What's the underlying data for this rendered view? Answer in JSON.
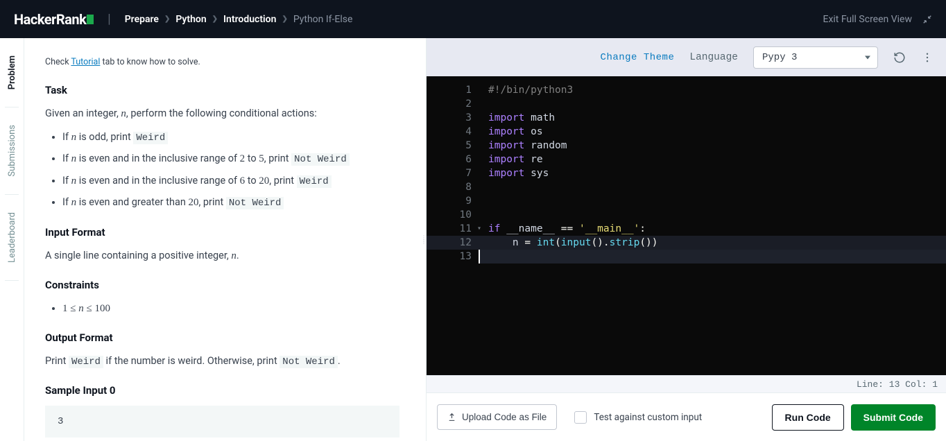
{
  "header": {
    "logo_text": "HackerRank",
    "breadcrumb": [
      "Prepare",
      "Python",
      "Introduction"
    ],
    "current_page": "Python If-Else",
    "exit_fs_label": "Exit Full Screen View"
  },
  "side_tabs": [
    {
      "label": "Problem",
      "active": true
    },
    {
      "label": "Submissions",
      "active": false
    },
    {
      "label": "Leaderboard",
      "active": false
    }
  ],
  "problem": {
    "hint_prefix": "Check ",
    "hint_link": "Tutorial",
    "hint_suffix": " tab to know how to solve.",
    "task_heading": "Task",
    "task_intro": "Given an integer, n, perform the following conditional actions:",
    "rules": [
      {
        "pre": "If ",
        "var": "n",
        "post": " is odd, print ",
        "code": "Weird"
      },
      {
        "pre": "If ",
        "var": "n",
        "post": " is even and in the inclusive range of 2 to 5, print ",
        "code": "Not Weird"
      },
      {
        "pre": "If ",
        "var": "n",
        "post": " is even and in the inclusive range of 6 to 20, print ",
        "code": "Weird"
      },
      {
        "pre": "If ",
        "var": "n",
        "post": " is even and greater than 20, print ",
        "code": "Not Weird"
      }
    ],
    "input_heading": "Input Format",
    "input_desc": "A single line containing a positive integer, n.",
    "constraints_heading": "Constraints",
    "constraint": "1 ≤ n ≤ 100",
    "output_heading": "Output Format",
    "output_desc_pre": "Print ",
    "output_code1": "Weird",
    "output_desc_mid": " if the number is weird. Otherwise, print ",
    "output_code2": "Not Weird",
    "output_desc_post": ".",
    "sample_input_heading": "Sample Input 0",
    "sample_input": "3"
  },
  "toolbar": {
    "change_theme": "Change Theme",
    "language_label": "Language",
    "language_selected": "Pypy 3"
  },
  "code": {
    "lines": [
      {
        "n": 1,
        "tokens": [
          [
            "comment",
            "#!/bin/python3"
          ]
        ]
      },
      {
        "n": 2,
        "tokens": []
      },
      {
        "n": 3,
        "tokens": [
          [
            "kw",
            "import"
          ],
          [
            "sp",
            " "
          ],
          [
            "mod",
            "math"
          ]
        ]
      },
      {
        "n": 4,
        "tokens": [
          [
            "kw",
            "import"
          ],
          [
            "sp",
            " "
          ],
          [
            "mod",
            "os"
          ]
        ]
      },
      {
        "n": 5,
        "tokens": [
          [
            "kw",
            "import"
          ],
          [
            "sp",
            " "
          ],
          [
            "mod",
            "random"
          ]
        ]
      },
      {
        "n": 6,
        "tokens": [
          [
            "kw",
            "import"
          ],
          [
            "sp",
            " "
          ],
          [
            "mod",
            "re"
          ]
        ]
      },
      {
        "n": 7,
        "tokens": [
          [
            "kw",
            "import"
          ],
          [
            "sp",
            " "
          ],
          [
            "mod",
            "sys"
          ]
        ]
      },
      {
        "n": 8,
        "tokens": []
      },
      {
        "n": 9,
        "tokens": []
      },
      {
        "n": 10,
        "tokens": []
      },
      {
        "n": 11,
        "fold": true,
        "tokens": [
          [
            "kw",
            "if"
          ],
          [
            "sp",
            " "
          ],
          [
            "mod",
            "__name__"
          ],
          [
            "sp",
            " "
          ],
          [
            "punc",
            "=="
          ],
          [
            "sp",
            " "
          ],
          [
            "str",
            "'__main__'"
          ],
          [
            "punc",
            ":"
          ]
        ]
      },
      {
        "n": 12,
        "hl": true,
        "tokens": [
          [
            "sp",
            "    "
          ],
          [
            "mod",
            "n "
          ],
          [
            "punc",
            "="
          ],
          [
            "sp",
            " "
          ],
          [
            "fn",
            "int"
          ],
          [
            "punc",
            "("
          ],
          [
            "fn",
            "input"
          ],
          [
            "punc",
            "()."
          ],
          [
            "fn",
            "strip"
          ],
          [
            "punc",
            "())"
          ]
        ]
      },
      {
        "n": 13,
        "current": true,
        "tokens": []
      }
    ]
  },
  "status": {
    "line": 13,
    "col": 1,
    "prefix": "Line: ",
    "col_prefix": " Col: "
  },
  "actions": {
    "upload_label": "Upload Code as File",
    "test_custom_label": "Test against custom input",
    "run_label": "Run Code",
    "submit_label": "Submit Code"
  }
}
